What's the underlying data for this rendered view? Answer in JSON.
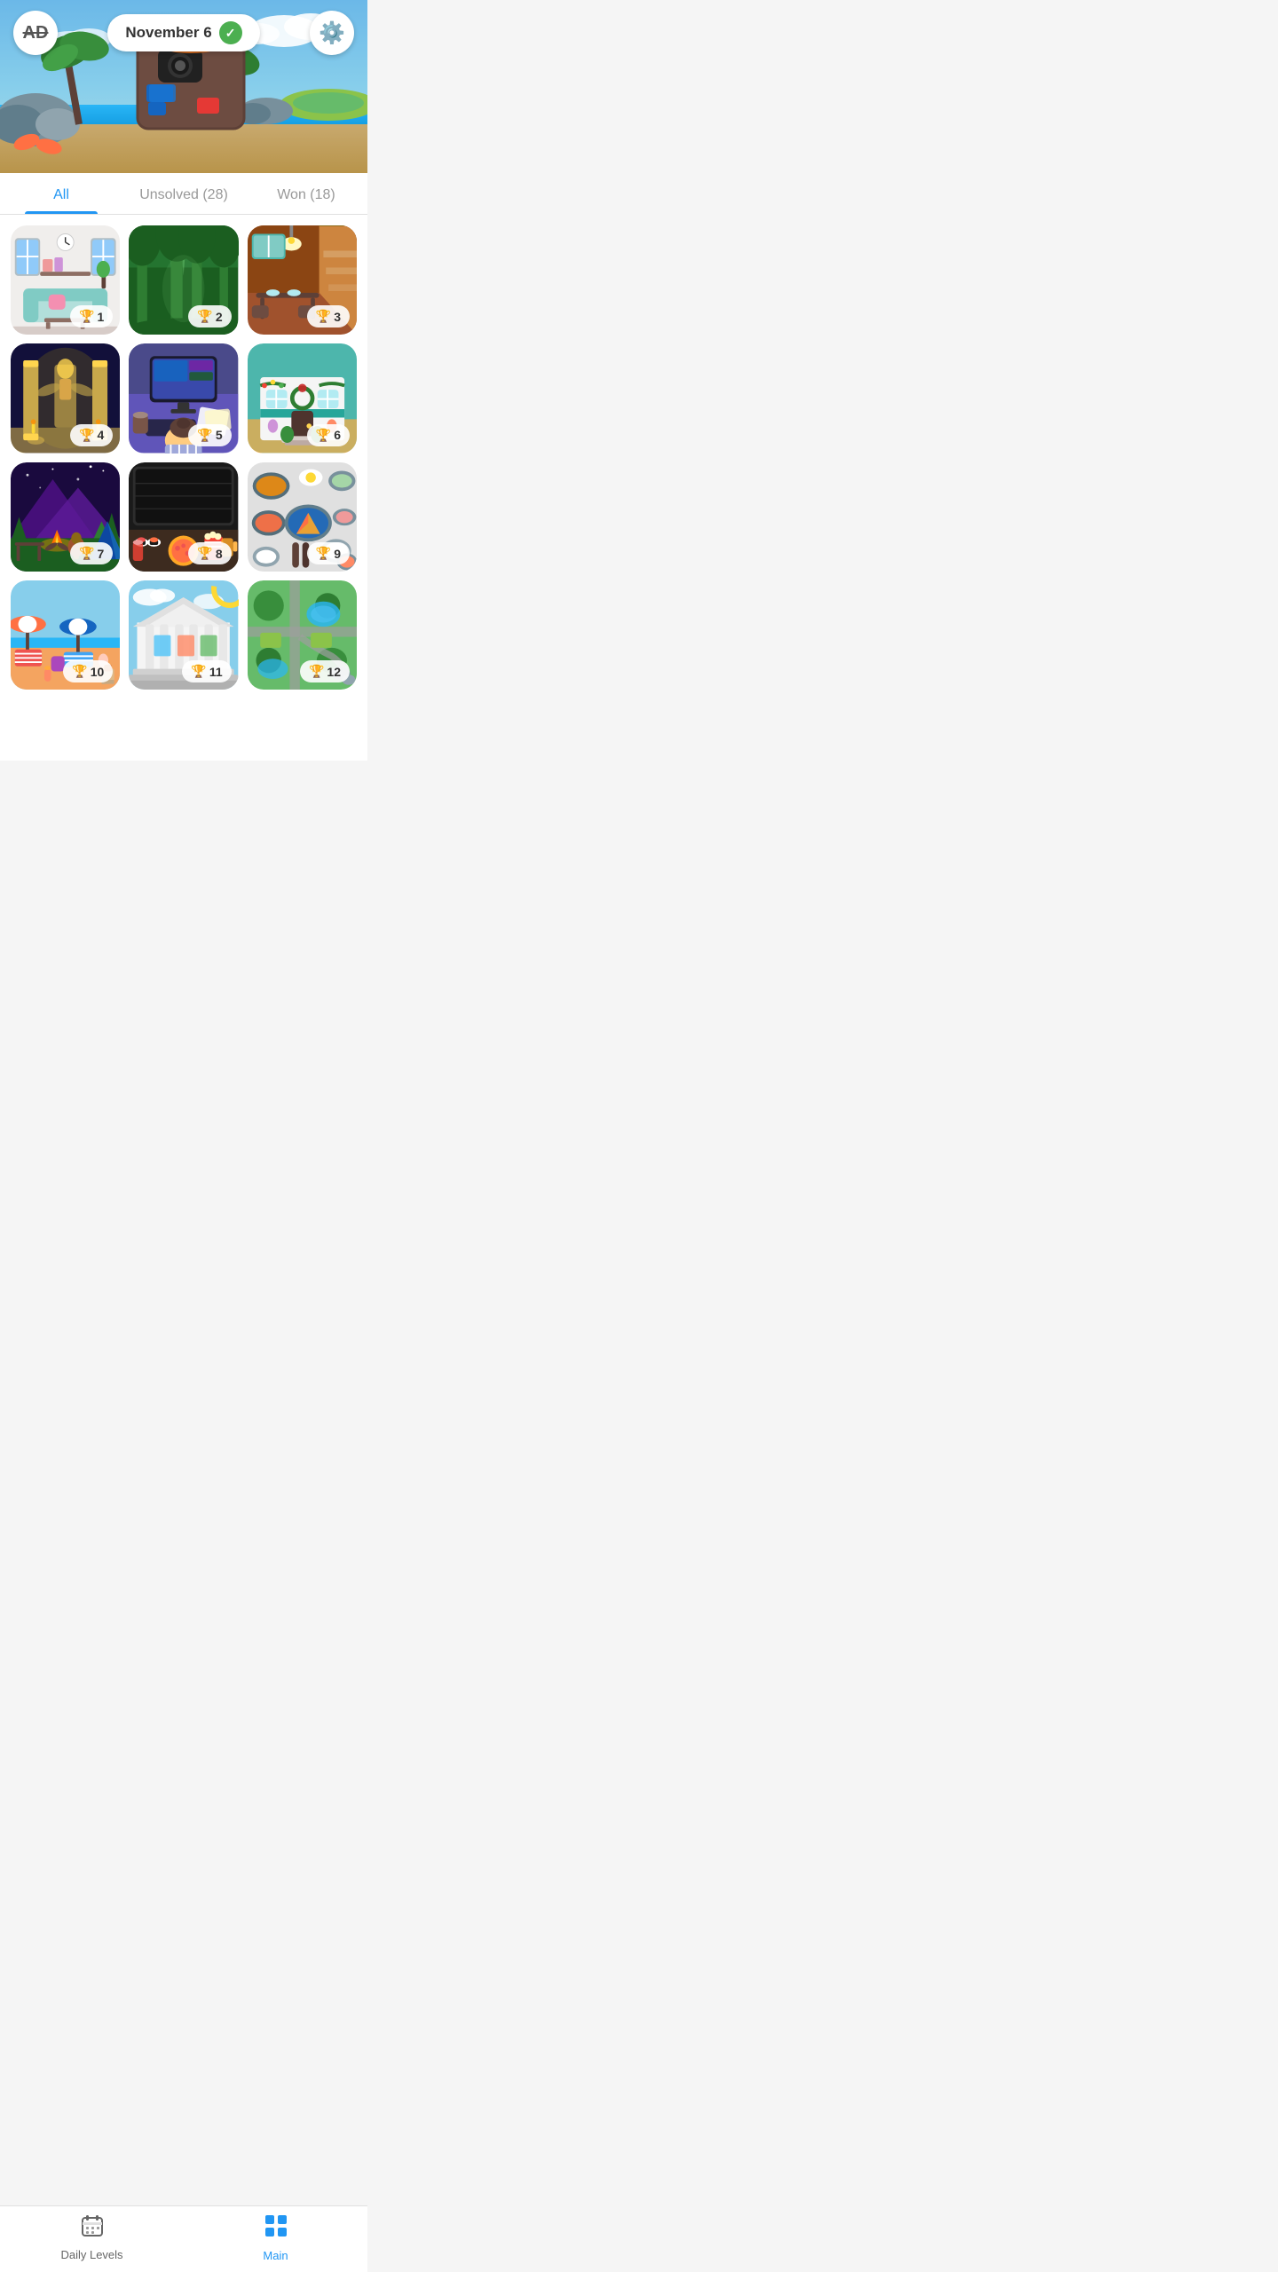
{
  "header": {
    "no_ads_icon": "🚫",
    "date_label": "November 6",
    "date_checked": true,
    "settings_icon": "⚙️"
  },
  "tabs": [
    {
      "id": "all",
      "label": "All",
      "active": true
    },
    {
      "id": "unsolved",
      "label": "Unsolved (28)",
      "active": false
    },
    {
      "id": "won",
      "label": "Won (18)",
      "active": false
    }
  ],
  "levels": [
    {
      "id": 1,
      "number": 1,
      "scene": "living-room",
      "emoji": "🛋️",
      "bg": "#f0f0ee"
    },
    {
      "id": 2,
      "number": 2,
      "scene": "forest",
      "emoji": "🌲",
      "bg": "#1a5e20"
    },
    {
      "id": 3,
      "number": 3,
      "scene": "restaurant",
      "emoji": "🏠",
      "bg": "#8B4513"
    },
    {
      "id": 4,
      "number": 4,
      "scene": "temple",
      "emoji": "🏛️",
      "bg": "#1a1a2e"
    },
    {
      "id": 5,
      "number": 5,
      "scene": "office",
      "emoji": "💻",
      "bg": "#4a4a8a"
    },
    {
      "id": 6,
      "number": 6,
      "scene": "house-exterior",
      "emoji": "🏡",
      "bg": "#4db6ac"
    },
    {
      "id": 7,
      "number": 7,
      "scene": "camping",
      "emoji": "🏕️",
      "bg": "#1a0a3e"
    },
    {
      "id": 8,
      "number": 8,
      "scene": "movie-food",
      "emoji": "🎬",
      "bg": "#1a1a1a"
    },
    {
      "id": 9,
      "number": 9,
      "scene": "food-flatlay",
      "emoji": "🍱",
      "bg": "#e0e0e0"
    },
    {
      "id": 10,
      "number": 10,
      "scene": "beach",
      "emoji": "🏖️",
      "bg": "#87CEEB"
    },
    {
      "id": 11,
      "number": 11,
      "scene": "building",
      "emoji": "🏛️",
      "bg": "#87CEEB"
    },
    {
      "id": 12,
      "number": 12,
      "scene": "park-map",
      "emoji": "🗺️",
      "bg": "#66BB6A"
    }
  ],
  "nav": {
    "daily_levels_icon": "📅",
    "daily_levels_label": "Daily Levels",
    "main_icon": "⊞",
    "main_label": "Main",
    "active": "main"
  },
  "colors": {
    "accent_blue": "#2196F3",
    "tab_active": "#2196F3",
    "nav_active": "#2196F3",
    "trophy_gold": "#FFD700",
    "check_green": "#4CAF50"
  }
}
